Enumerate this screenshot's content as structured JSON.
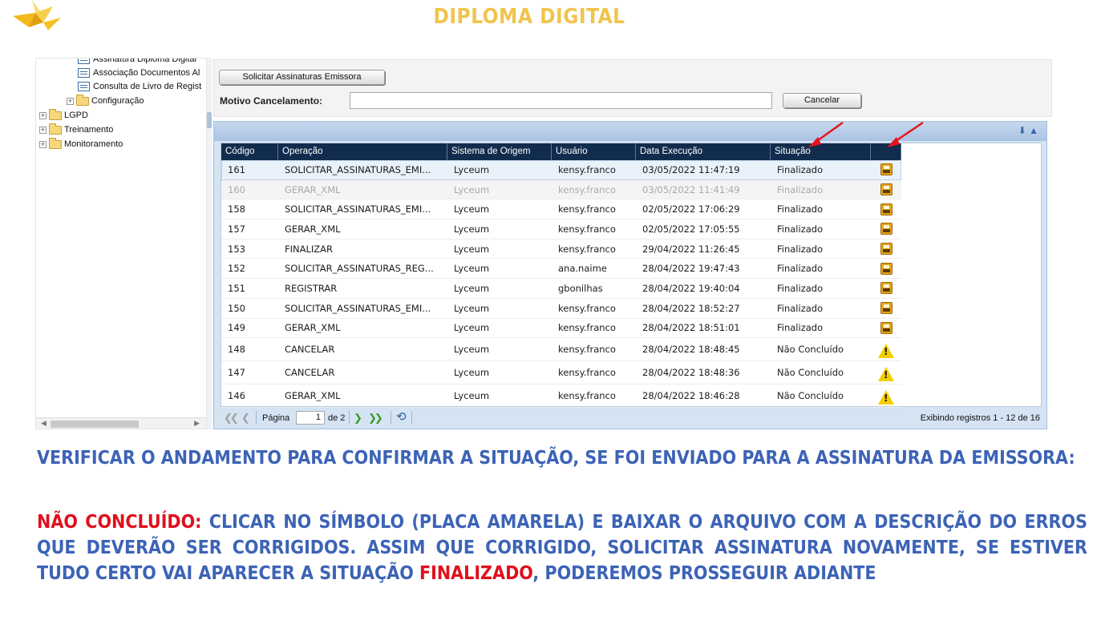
{
  "slide": {
    "title": "DIPLOMA DIGITAL",
    "logo_icon": "paper-crane-logo-icon"
  },
  "tree": {
    "items": [
      {
        "label": "Assinatura Diploma Digital",
        "icon": "document-icon"
      },
      {
        "label": "Associação Documentos Al",
        "icon": "document-icon"
      },
      {
        "label": "Consulta de Livro de Regist",
        "icon": "document-icon"
      },
      {
        "label": "Configuração",
        "icon": "folder-icon"
      },
      {
        "label": "LGPD",
        "icon": "folder-icon"
      },
      {
        "label": "Treinamento",
        "icon": "folder-icon"
      },
      {
        "label": "Monitoramento",
        "icon": "folder-icon"
      }
    ],
    "expand_glyph": "+"
  },
  "toolbar": {
    "solicitar_label": "Solicitar Assinaturas Emissora",
    "motivo_label": "Motivo Cancelamento:",
    "motivo_value": "",
    "cancelar_label": "Cancelar"
  },
  "grid": {
    "columns": [
      "Código",
      "Operação",
      "Sistema de Origem",
      "Usuário",
      "Data Execução",
      "Situação",
      ""
    ],
    "rows": [
      {
        "codigo": "161",
        "operacao": "SOLICITAR_ASSINATURAS_EMI...",
        "sistema": "Lyceum",
        "usuario": "kensy.franco",
        "data": "03/05/2022 11:47:19",
        "situacao": "Finalizado",
        "icon": "download-file-icon",
        "state": "selected"
      },
      {
        "codigo": "160",
        "operacao": "GERAR_XML",
        "sistema": "Lyceum",
        "usuario": "kensy.franco",
        "data": "03/05/2022 11:41:49",
        "situacao": "Finalizado",
        "icon": "download-file-icon",
        "state": "dimmed"
      },
      {
        "codigo": "158",
        "operacao": "SOLICITAR_ASSINATURAS_EMI...",
        "sistema": "Lyceum",
        "usuario": "kensy.franco",
        "data": "02/05/2022 17:06:29",
        "situacao": "Finalizado",
        "icon": "download-file-icon",
        "state": "normal"
      },
      {
        "codigo": "157",
        "operacao": "GERAR_XML",
        "sistema": "Lyceum",
        "usuario": "kensy.franco",
        "data": "02/05/2022 17:05:55",
        "situacao": "Finalizado",
        "icon": "download-file-icon",
        "state": "normal"
      },
      {
        "codigo": "153",
        "operacao": "FINALIZAR",
        "sistema": "Lyceum",
        "usuario": "kensy.franco",
        "data": "29/04/2022 11:26:45",
        "situacao": "Finalizado",
        "icon": "download-file-icon",
        "state": "normal"
      },
      {
        "codigo": "152",
        "operacao": "SOLICITAR_ASSINATURAS_REG...",
        "sistema": "Lyceum",
        "usuario": "ana.naime",
        "data": "28/04/2022 19:47:43",
        "situacao": "Finalizado",
        "icon": "download-file-icon",
        "state": "normal"
      },
      {
        "codigo": "151",
        "operacao": "REGISTRAR",
        "sistema": "Lyceum",
        "usuario": "gbonilhas",
        "data": "28/04/2022 19:40:04",
        "situacao": "Finalizado",
        "icon": "download-file-icon",
        "state": "normal"
      },
      {
        "codigo": "150",
        "operacao": "SOLICITAR_ASSINATURAS_EMI...",
        "sistema": "Lyceum",
        "usuario": "kensy.franco",
        "data": "28/04/2022 18:52:27",
        "situacao": "Finalizado",
        "icon": "download-file-icon",
        "state": "normal"
      },
      {
        "codigo": "149",
        "operacao": "GERAR_XML",
        "sistema": "Lyceum",
        "usuario": "kensy.franco",
        "data": "28/04/2022 18:51:01",
        "situacao": "Finalizado",
        "icon": "download-file-icon",
        "state": "normal"
      },
      {
        "codigo": "148",
        "operacao": "CANCELAR",
        "sistema": "Lyceum",
        "usuario": "kensy.franco",
        "data": "28/04/2022 18:48:45",
        "situacao": "Não Concluído",
        "icon": "warning-icon",
        "state": "warning"
      },
      {
        "codigo": "147",
        "operacao": "CANCELAR",
        "sistema": "Lyceum",
        "usuario": "kensy.franco",
        "data": "28/04/2022 18:48:36",
        "situacao": "Não Concluído",
        "icon": "warning-icon",
        "state": "warning"
      },
      {
        "codigo": "146",
        "operacao": "GERAR_XML",
        "sistema": "Lyceum",
        "usuario": "kensy.franco",
        "data": "28/04/2022 18:46:28",
        "situacao": "Não Concluído",
        "icon": "warning-icon",
        "state": "warning"
      }
    ]
  },
  "pager": {
    "page_label": "Página",
    "page_value": "1",
    "of_label": "de 2",
    "info": "Exibindo registros 1 - 12 de 16"
  },
  "instructions": {
    "line1": "VERIFICAR O ANDAMENTO PARA CONFIRMAR A SITUAÇÃO, SE FOI ENVIADO PARA A ASSINATURA DA EMISSORA:",
    "nao_concluido": "NÃO CONCLUÍDO:",
    "body": " CLICAR NO SÍMBOLO (PLACA AMARELA) E BAIXAR O ARQUIVO COM A DESCRIÇÃO DO ERROS QUE DEVERÃO SER CORRIGIDOS. ASSIM QUE CORRIGIDO, SOLICITAR ASSINATURA NOVAMENTE, SE ESTIVER TUDO CERTO VAI APARECER A SITUAÇÃO ",
    "finalizado": "FINALIZADO",
    "tail": ", PODEREMOS PROSSEGUIR ADIANTE"
  },
  "colors": {
    "title": "#f0c44c",
    "instructions": "#3c63b6",
    "highlight": "#e0101c",
    "grid_header": "#112c4d"
  }
}
